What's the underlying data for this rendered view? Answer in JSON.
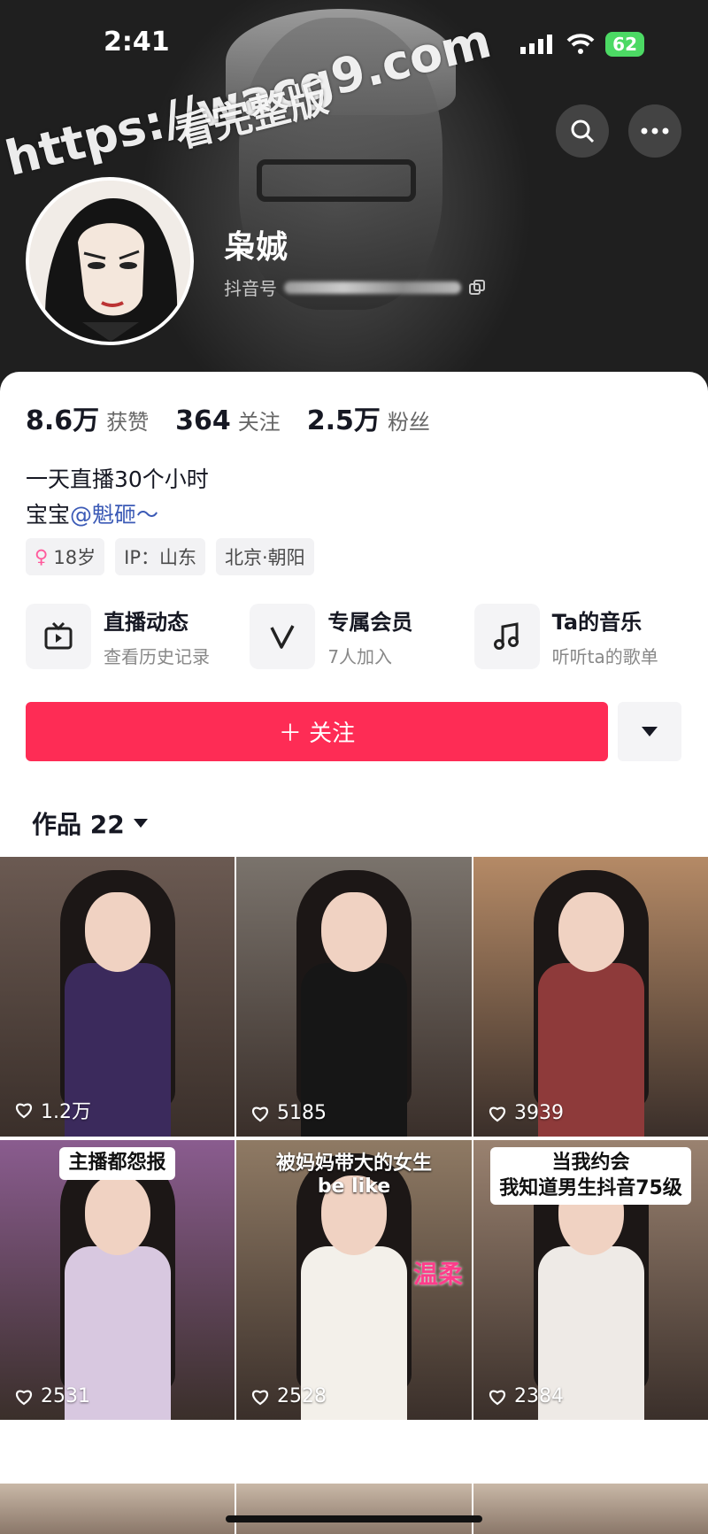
{
  "status": {
    "time": "2:41",
    "battery": "62"
  },
  "watermark": {
    "line1": "https://wacg9.com",
    "line2": "看完整版"
  },
  "profile": {
    "name": "枭娍",
    "douyin_id_label": "抖音号"
  },
  "stats": [
    {
      "value": "8.6万",
      "label": "获赞"
    },
    {
      "value": "364",
      "label": "关注"
    },
    {
      "value": "2.5万",
      "label": "粉丝"
    }
  ],
  "bio": {
    "line1": "一天直播30个小时",
    "line2_prefix": "宝宝",
    "mention": "@魁砸～"
  },
  "tags": [
    "18岁",
    "IP：山东",
    "北京·朝阳"
  ],
  "features": [
    {
      "title": "直播动态",
      "subtitle": "查看历史记录",
      "icon": "tv-icon"
    },
    {
      "title": "专属会员",
      "subtitle": "7人加入",
      "icon": "v-icon"
    },
    {
      "title": "Ta的音乐",
      "subtitle": "听听ta的歌单",
      "icon": "music-note-icon"
    }
  ],
  "follow_button": "＋ 关注",
  "works": {
    "label": "作品 22"
  },
  "videos": [
    {
      "likes": "1.2万",
      "caption": "",
      "bg": "#6b5a52",
      "dress": "#3b2a5c"
    },
    {
      "likes": "5185",
      "caption": "",
      "bg": "#7a736c",
      "dress": "#161616"
    },
    {
      "likes": "3939",
      "caption": "",
      "bg": "#b58a66",
      "dress": "#8e3a3a"
    },
    {
      "likes": "2531",
      "caption": "主播都怨报",
      "bg": "#8a5c8f",
      "dress": "#d8c8e0"
    },
    {
      "likes": "2528",
      "caption": "被妈妈带大的女生\nbe like",
      "overlay": "温柔",
      "bg": "#8f7a64",
      "dress": "#f3f0ea"
    },
    {
      "likes": "2384",
      "caption": "当我约会\n我知道男生抖音75级",
      "bg": "#9a8270",
      "dress": "#eeeae6"
    }
  ]
}
